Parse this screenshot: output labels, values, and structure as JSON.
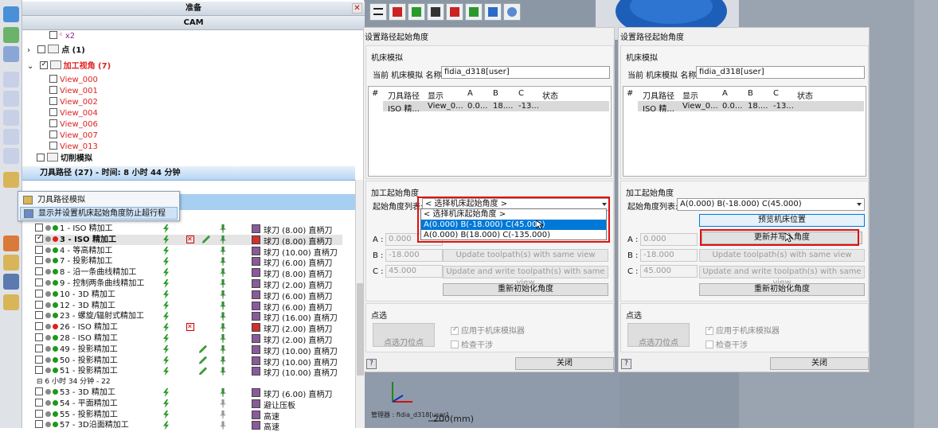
{
  "tree": {
    "prep_bar": "准备",
    "cam_bar": "CAM",
    "items": {
      "x2": "x2",
      "points": "点 (1)",
      "views": "加工视角 (7)",
      "view_list": [
        "View_000",
        "View_001",
        "View_002",
        "View_004",
        "View_006",
        "View_007",
        "View_013"
      ],
      "cut_sim": "切削模拟"
    },
    "toolpath_bar": "刀具路径 (27) - 时间: 8 小时 44 分钟",
    "subgroup_time": "6 小时 34 分钟 - 22",
    "ops": [
      {
        "label": "1 - ISO 精加工",
        "tool": "球刀 (8.00) 直柄刀",
        "dot": "#1a9a1a"
      },
      {
        "label": "3 - ISO 精加工",
        "tool": "球刀 (8.00) 直柄刀",
        "dot": "#e02020"
      },
      {
        "label": "4 - 等高精加工",
        "tool": "球刀 (10.00) 直柄刀",
        "dot": "#1a9a1a"
      },
      {
        "label": "7 - 投影精加工",
        "tool": "球刀 (6.00) 直柄刀",
        "dot": "#1a9a1a"
      },
      {
        "label": "8 - 沿一条曲线精加工",
        "tool": "球刀 (8.00) 直柄刀",
        "dot": "#1a9a1a"
      },
      {
        "label": "9 - 控制两条曲线精加工",
        "tool": "球刀 (2.00) 直柄刀",
        "dot": "#1a9a1a"
      },
      {
        "label": "10 - 3D 精加工",
        "tool": "球刀 (6.00) 直柄刀",
        "dot": "#1a9a1a"
      },
      {
        "label": "12 - 3D 精加工",
        "tool": "球刀 (6.00) 直柄刀",
        "dot": "#1a9a1a"
      },
      {
        "label": "23 - 螺旋/辐射式精加工",
        "tool": "球刀 (16.00) 直柄刀",
        "dot": "#1a9a1a"
      },
      {
        "label": "26 - ISO 精加工",
        "tool": "球刀 (2.00) 直柄刀",
        "dot": "#e02020"
      },
      {
        "label": "28 - ISO 精加工",
        "tool": "球刀 (2.00) 直柄刀",
        "dot": "#1a9a1a"
      },
      {
        "label": "49 - 投影精加工",
        "tool": "球刀 (10.00) 直柄刀",
        "dot": "#1a9a1a"
      },
      {
        "label": "50 - 投影精加工",
        "tool": "球刀 (10.00) 直柄刀",
        "dot": "#1a9a1a"
      },
      {
        "label": "51 - 投影精加工",
        "tool": "球刀 (10.00) 直柄刀",
        "dot": "#1a9a1a"
      }
    ],
    "ops2": [
      {
        "label": "53 - 3D 精加工",
        "tool": "球刀 (6.00) 直柄刀",
        "dot": "#1a9a1a"
      },
      {
        "label": "54 - 平面精加工",
        "tool": "避让压板",
        "dot": "#1a9a1a"
      },
      {
        "label": "55 - 投影精加工",
        "tool": "高速",
        "dot": "#1a9a1a"
      },
      {
        "label": "57 - 3D沿面精加工",
        "tool": "高速",
        "dot": "#1a9a1a"
      }
    ]
  },
  "context_menu": {
    "item1": "刀具路径模拟",
    "item2": "显示并设置机床起始角度防止超行程"
  },
  "dialog_left": {
    "title": "设置路径起始角度",
    "machine_group": "机床模拟",
    "current_label": "当前 机床模拟 名称:",
    "current_value": "fidia_d318[user]",
    "table_headers": [
      "#",
      "刀具路径",
      "显示",
      "A",
      "B",
      "C",
      "状态"
    ],
    "table_row": [
      "",
      "ISO 精...",
      "View_0...",
      "0.0...",
      "18....",
      "-13...",
      ""
    ],
    "angle_group": "加工起始角度",
    "angle_list_label": "起始角度列表:",
    "angle_list_value": "< 选择机床起始角度 >",
    "options": [
      "< 选择机床起始角度 >",
      "A(0.000)  B(-18.000)  C(45.000)",
      "A(0.000)  B(18.000)  C(-135.000)"
    ],
    "a_label": "A :",
    "a_value": "0.000",
    "b_label": "B :",
    "b_value": "-18.000",
    "c_label": "C :",
    "c_value": "45.000",
    "update_btn": "Update toolpath(s) with same view",
    "update_write_btn": "Update and write toolpath(s) with same view",
    "reinit_btn": "重新初始化角度",
    "pick_group": "点选",
    "pick_btn": "点选刀位点",
    "apply_chk": "应用于机床模拟器",
    "check_chk": "检查干涉",
    "help": "?",
    "close_btn": "关闭"
  },
  "dialog_right": {
    "title": "设置路径起始角度",
    "machine_group": "机床模拟",
    "current_label": "当前 机床模拟 名称:",
    "current_value": "fidia_d318[user]",
    "table_headers": [
      "#",
      "刀具路径",
      "显示",
      "A",
      "B",
      "C",
      "状态"
    ],
    "table_row": [
      "",
      "ISO 精...",
      "View_0...",
      "0.0...",
      "18....",
      "-13...",
      ""
    ],
    "angle_group": "加工起始角度",
    "angle_list_label": "起始角度列表:",
    "angle_list_value": "A(0.000)  B(-18.000)  C(45.000)",
    "preview_btn": "预览机床位置",
    "update_write_cn": "更新并写入角度",
    "a_label": "A :",
    "a_value": "0.000",
    "b_label": "B :",
    "b_value": "-18.000",
    "c_label": "C :",
    "c_value": "45.000",
    "update_btn": "Update toolpath(s) with same view",
    "update_write_btn": "Update and write toolpath(s) with same view",
    "reinit_btn": "重新初始化角度",
    "pick_group": "点选",
    "pick_btn": "点选刀位点",
    "apply_chk": "应用于机床模拟器",
    "check_chk": "检查干涉",
    "help": "?",
    "close_btn": "关闭"
  },
  "viewport": {
    "status": "管理器 : fidia_d318[user]",
    "scale": "200(mm)"
  },
  "colors": {
    "accent_red": "#e01010",
    "selection_blue": "#0078d7"
  }
}
